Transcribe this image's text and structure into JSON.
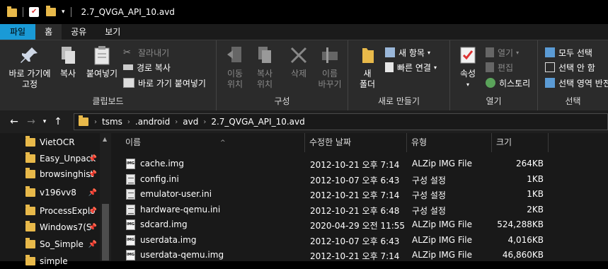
{
  "window": {
    "title": "2.7_QVGA_API_10.avd"
  },
  "tabs": [
    "파일",
    "홈",
    "공유",
    "보기"
  ],
  "ribbon": {
    "clipboard": {
      "pin_label1": "바로 가기에",
      "pin_label2": "고정",
      "copy": "복사",
      "paste": "붙여넣기",
      "cut": "잘라내기",
      "copy_path": "경로 복사",
      "paste_shortcut": "바로 가기 붙여넣기",
      "group": "클립보드"
    },
    "organize": {
      "move1": "이동",
      "move2": "위치",
      "copy1": "복사",
      "copy2": "위치",
      "delete": "삭제",
      "rename1": "이름",
      "rename2": "바꾸기",
      "group": "구성"
    },
    "new": {
      "folder1": "새",
      "folder2": "폴더",
      "new_item": "새 항목",
      "easy_access": "빠른 연결",
      "group": "새로 만들기"
    },
    "open": {
      "properties": "속성",
      "open": "열기",
      "edit": "편집",
      "history": "히스토리",
      "group": "열기"
    },
    "select": {
      "select_all": "모두 선택",
      "select_none": "선택 안 함",
      "invert": "선택 영역 반전",
      "group": "선택"
    }
  },
  "address": {
    "crumbs": [
      "tsms",
      ".android",
      "avd",
      "2.7_QVGA_API_10.avd"
    ]
  },
  "sidebar": {
    "items": [
      "VietOCR",
      "Easy_Unpack",
      "browsinghist",
      "v196vv8",
      "ProcessExplo",
      "Windows7(S",
      "So_Simple",
      "simple"
    ]
  },
  "columns": {
    "name": "이름",
    "date": "수정한 날짜",
    "type": "유형",
    "size": "크기"
  },
  "files": [
    {
      "name": "cache.img",
      "date": "2012-10-21 오후 7:14",
      "type": "ALZip IMG File",
      "size": "264KB",
      "kind": "img"
    },
    {
      "name": "config.ini",
      "date": "2012-10-07 오후 6:43",
      "type": "구성 설정",
      "size": "1KB",
      "kind": "ini"
    },
    {
      "name": "emulator-user.ini",
      "date": "2012-10-21 오후 7:14",
      "type": "구성 설정",
      "size": "1KB",
      "kind": "ini"
    },
    {
      "name": "hardware-qemu.ini",
      "date": "2012-10-21 오후 6:48",
      "type": "구성 설정",
      "size": "2KB",
      "kind": "ini"
    },
    {
      "name": "sdcard.img",
      "date": "2020-04-29 오전 11:55",
      "type": "ALZip IMG File",
      "size": "524,288KB",
      "kind": "img"
    },
    {
      "name": "userdata.img",
      "date": "2012-10-07 오후 6:43",
      "type": "ALZip IMG File",
      "size": "4,016KB",
      "kind": "img"
    },
    {
      "name": "userdata-qemu.img",
      "date": "2012-10-21 오후 7:14",
      "type": "ALZip IMG File",
      "size": "46,860KB",
      "kind": "img"
    }
  ],
  "colors": {
    "accent": "#1a9ad6",
    "folder": "#e8b94a"
  }
}
